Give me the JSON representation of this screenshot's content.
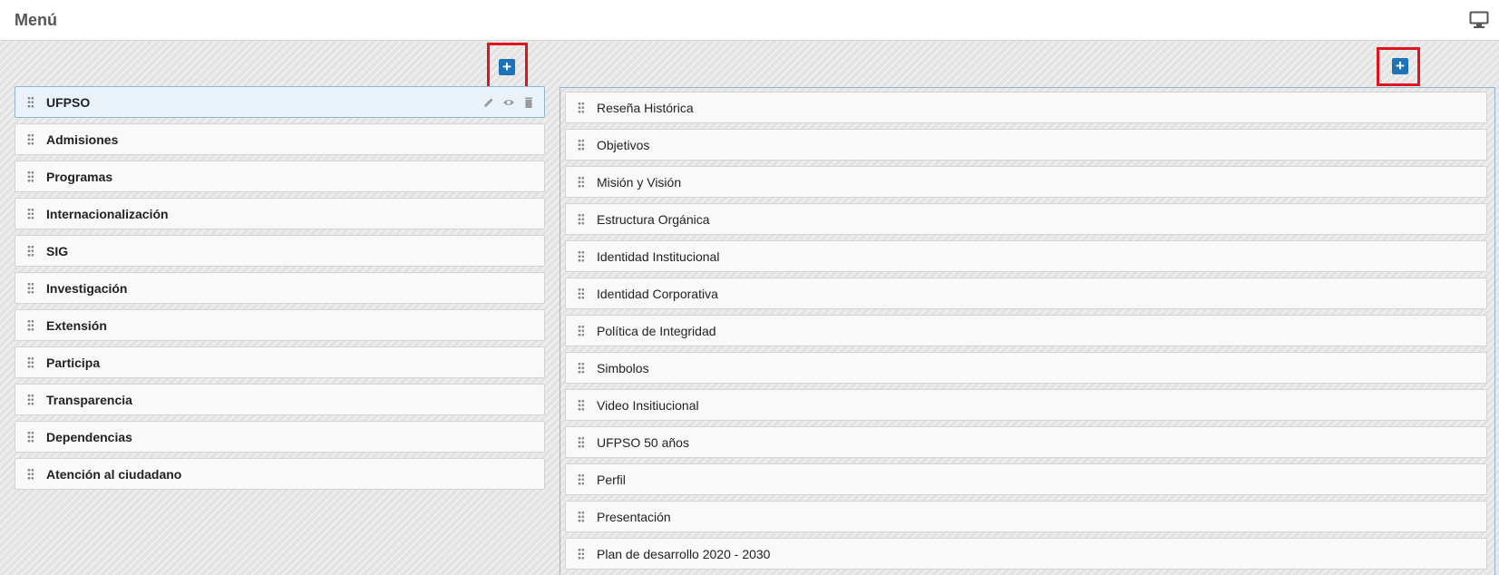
{
  "header": {
    "title": "Menú",
    "monitor_icon": "monitor-icon"
  },
  "left_panel": {
    "add_button_label": "+",
    "items": [
      {
        "label": "UFPSO"
      },
      {
        "label": "Admisiones"
      },
      {
        "label": "Programas"
      },
      {
        "label": "Internacionalización"
      },
      {
        "label": "SIG"
      },
      {
        "label": "Investigación"
      },
      {
        "label": "Extensión"
      },
      {
        "label": "Participa"
      },
      {
        "label": "Transparencia"
      },
      {
        "label": "Dependencias"
      },
      {
        "label": "Atención al ciudadano"
      }
    ],
    "active_item_actions": [
      "pencil-icon",
      "eye-icon",
      "trash-icon"
    ]
  },
  "right_panel": {
    "add_button_label": "+",
    "items": [
      {
        "label": "Reseña Histórica"
      },
      {
        "label": "Objetivos"
      },
      {
        "label": "Misión y Visión"
      },
      {
        "label": "Estructura Orgánica"
      },
      {
        "label": "Identidad Institucional"
      },
      {
        "label": "Identidad Corporativa"
      },
      {
        "label": "Política de Integridad"
      },
      {
        "label": "Simbolos"
      },
      {
        "label": "Video Insitiucional"
      },
      {
        "label": "UFPSO 50 años"
      },
      {
        "label": "Perfil"
      },
      {
        "label": "Presentación"
      },
      {
        "label": "Plan de desarrollo 2020 - 2030"
      }
    ]
  },
  "colors": {
    "accent": "#1d72b8",
    "highlight": "#e0141e",
    "active_border": "#8fb4d6"
  }
}
